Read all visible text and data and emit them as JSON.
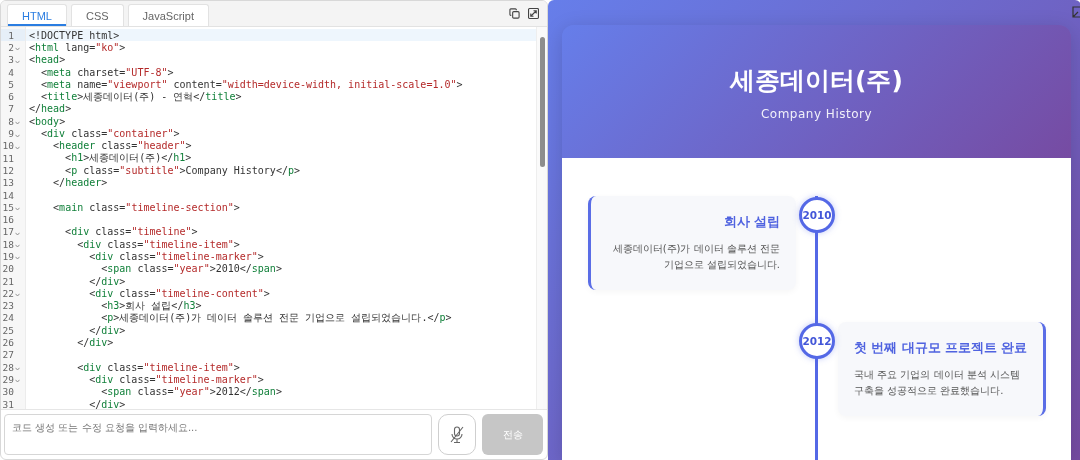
{
  "editor": {
    "tabs": [
      {
        "label": "HTML",
        "selected": true
      },
      {
        "label": "CSS",
        "selected": false
      },
      {
        "label": "JavaScript",
        "selected": false
      }
    ],
    "lines": [
      {
        "number": "1",
        "foldable": false,
        "current": true,
        "tokens": [
          {
            "kind": "text",
            "text": "<!DOCTYPE html>"
          }
        ]
      },
      {
        "number": "2",
        "foldable": true,
        "current": false,
        "tokens": [
          {
            "kind": "text",
            "text": "<"
          },
          {
            "kind": "tag",
            "text": "html"
          },
          {
            "kind": "text",
            "text": " lang="
          },
          {
            "kind": "str",
            "text": "\"ko\""
          },
          {
            "kind": "text",
            "text": ">"
          }
        ]
      },
      {
        "number": "3",
        "foldable": true,
        "current": false,
        "tokens": [
          {
            "kind": "text",
            "text": "<"
          },
          {
            "kind": "tag",
            "text": "head"
          },
          {
            "kind": "text",
            "text": ">"
          }
        ]
      },
      {
        "number": "4",
        "foldable": false,
        "current": false,
        "tokens": [
          {
            "kind": "text",
            "text": "  <"
          },
          {
            "kind": "tag",
            "text": "meta"
          },
          {
            "kind": "text",
            "text": " charset="
          },
          {
            "kind": "str",
            "text": "\"UTF-8\""
          },
          {
            "kind": "text",
            "text": ">"
          }
        ]
      },
      {
        "number": "5",
        "foldable": false,
        "current": false,
        "tokens": [
          {
            "kind": "text",
            "text": "  <"
          },
          {
            "kind": "tag",
            "text": "meta"
          },
          {
            "kind": "text",
            "text": " name="
          },
          {
            "kind": "str",
            "text": "\"viewport\""
          },
          {
            "kind": "text",
            "text": " content="
          },
          {
            "kind": "str",
            "text": "\"width=device-width, initial-scale=1.0\""
          },
          {
            "kind": "text",
            "text": ">"
          }
        ]
      },
      {
        "number": "6",
        "foldable": false,
        "current": false,
        "tokens": [
          {
            "kind": "text",
            "text": "  <"
          },
          {
            "kind": "tag",
            "text": "title"
          },
          {
            "kind": "text",
            "text": ">세종데이터(주) - 연혁</"
          },
          {
            "kind": "tag",
            "text": "title"
          },
          {
            "kind": "text",
            "text": ">"
          }
        ]
      },
      {
        "number": "7",
        "foldable": false,
        "current": false,
        "tokens": [
          {
            "kind": "text",
            "text": "</"
          },
          {
            "kind": "tag",
            "text": "head"
          },
          {
            "kind": "text",
            "text": ">"
          }
        ]
      },
      {
        "number": "8",
        "foldable": true,
        "current": false,
        "tokens": [
          {
            "kind": "text",
            "text": "<"
          },
          {
            "kind": "tag",
            "text": "body"
          },
          {
            "kind": "text",
            "text": ">"
          }
        ]
      },
      {
        "number": "9",
        "foldable": true,
        "current": false,
        "tokens": [
          {
            "kind": "text",
            "text": "  <"
          },
          {
            "kind": "tag",
            "text": "div"
          },
          {
            "kind": "text",
            "text": " class="
          },
          {
            "kind": "str",
            "text": "\"container\""
          },
          {
            "kind": "text",
            "text": ">"
          }
        ]
      },
      {
        "number": "10",
        "foldable": true,
        "current": false,
        "tokens": [
          {
            "kind": "text",
            "text": "    <"
          },
          {
            "kind": "tag",
            "text": "header"
          },
          {
            "kind": "text",
            "text": " class="
          },
          {
            "kind": "str",
            "text": "\"header\""
          },
          {
            "kind": "text",
            "text": ">"
          }
        ]
      },
      {
        "number": "11",
        "foldable": false,
        "current": false,
        "tokens": [
          {
            "kind": "text",
            "text": "      <"
          },
          {
            "kind": "tag",
            "text": "h1"
          },
          {
            "kind": "text",
            "text": ">세종데이터(주)</"
          },
          {
            "kind": "tag",
            "text": "h1"
          },
          {
            "kind": "text",
            "text": ">"
          }
        ]
      },
      {
        "number": "12",
        "foldable": false,
        "current": false,
        "tokens": [
          {
            "kind": "text",
            "text": "      <"
          },
          {
            "kind": "tag",
            "text": "p"
          },
          {
            "kind": "text",
            "text": " class="
          },
          {
            "kind": "str",
            "text": "\"subtitle\""
          },
          {
            "kind": "text",
            "text": ">Company History</"
          },
          {
            "kind": "tag",
            "text": "p"
          },
          {
            "kind": "text",
            "text": ">"
          }
        ]
      },
      {
        "number": "13",
        "foldable": false,
        "current": false,
        "tokens": [
          {
            "kind": "text",
            "text": "    </"
          },
          {
            "kind": "tag",
            "text": "header"
          },
          {
            "kind": "text",
            "text": ">"
          }
        ]
      },
      {
        "number": "14",
        "foldable": false,
        "current": false
      },
      {
        "number": "15",
        "foldable": true,
        "current": false,
        "tokens": [
          {
            "kind": "text",
            "text": "    <"
          },
          {
            "kind": "tag",
            "text": "main"
          },
          {
            "kind": "text",
            "text": " class="
          },
          {
            "kind": "str",
            "text": "\"timeline-section\""
          },
          {
            "kind": "text",
            "text": ">"
          }
        ]
      },
      {
        "number": "16",
        "foldable": false,
        "current": false
      },
      {
        "number": "17",
        "foldable": true,
        "current": false,
        "tokens": [
          {
            "kind": "text",
            "text": "      <"
          },
          {
            "kind": "tag",
            "text": "div"
          },
          {
            "kind": "text",
            "text": " class="
          },
          {
            "kind": "str",
            "text": "\"timeline\""
          },
          {
            "kind": "text",
            "text": ">"
          }
        ]
      },
      {
        "number": "18",
        "foldable": true,
        "current": false,
        "tokens": [
          {
            "kind": "text",
            "text": "        <"
          },
          {
            "kind": "tag",
            "text": "div"
          },
          {
            "kind": "text",
            "text": " class="
          },
          {
            "kind": "str",
            "text": "\"timeline-item\""
          },
          {
            "kind": "text",
            "text": ">"
          }
        ]
      },
      {
        "number": "19",
        "foldable": true,
        "current": false,
        "tokens": [
          {
            "kind": "text",
            "text": "          <"
          },
          {
            "kind": "tag",
            "text": "div"
          },
          {
            "kind": "text",
            "text": " class="
          },
          {
            "kind": "str",
            "text": "\"timeline-marker\""
          },
          {
            "kind": "text",
            "text": ">"
          }
        ]
      },
      {
        "number": "20",
        "foldable": false,
        "current": false,
        "tokens": [
          {
            "kind": "text",
            "text": "            <"
          },
          {
            "kind": "tag",
            "text": "span"
          },
          {
            "kind": "text",
            "text": " class="
          },
          {
            "kind": "str",
            "text": "\"year\""
          },
          {
            "kind": "text",
            "text": ">2010</"
          },
          {
            "kind": "tag",
            "text": "span"
          },
          {
            "kind": "text",
            "text": ">"
          }
        ]
      },
      {
        "number": "21",
        "foldable": false,
        "current": false,
        "tokens": [
          {
            "kind": "text",
            "text": "          </"
          },
          {
            "kind": "tag",
            "text": "div"
          },
          {
            "kind": "text",
            "text": ">"
          }
        ]
      },
      {
        "number": "22",
        "foldable": true,
        "current": false,
        "tokens": [
          {
            "kind": "text",
            "text": "          <"
          },
          {
            "kind": "tag",
            "text": "div"
          },
          {
            "kind": "text",
            "text": " class="
          },
          {
            "kind": "str",
            "text": "\"timeline-content\""
          },
          {
            "kind": "text",
            "text": ">"
          }
        ]
      },
      {
        "number": "23",
        "foldable": false,
        "current": false,
        "tokens": [
          {
            "kind": "text",
            "text": "            <"
          },
          {
            "kind": "tag",
            "text": "h3"
          },
          {
            "kind": "text",
            "text": ">회사 설립</"
          },
          {
            "kind": "tag",
            "text": "h3"
          },
          {
            "kind": "text",
            "text": ">"
          }
        ]
      },
      {
        "number": "24",
        "foldable": false,
        "current": false,
        "tokens": [
          {
            "kind": "text",
            "text": "            <"
          },
          {
            "kind": "tag",
            "text": "p"
          },
          {
            "kind": "text",
            "text": ">세종데이터(주)가 데이터 솔루션 전문 기업으로 설립되었습니다.</"
          },
          {
            "kind": "tag",
            "text": "p"
          },
          {
            "kind": "text",
            "text": ">"
          }
        ]
      },
      {
        "number": "25",
        "foldable": false,
        "current": false,
        "tokens": [
          {
            "kind": "text",
            "text": "          </"
          },
          {
            "kind": "tag",
            "text": "div"
          },
          {
            "kind": "text",
            "text": ">"
          }
        ]
      },
      {
        "number": "26",
        "foldable": false,
        "current": false,
        "tokens": [
          {
            "kind": "text",
            "text": "        </"
          },
          {
            "kind": "tag",
            "text": "div"
          },
          {
            "kind": "text",
            "text": ">"
          }
        ]
      },
      {
        "number": "27",
        "foldable": false,
        "current": false
      },
      {
        "number": "28",
        "foldable": true,
        "current": false,
        "tokens": [
          {
            "kind": "text",
            "text": "        <"
          },
          {
            "kind": "tag",
            "text": "div"
          },
          {
            "kind": "text",
            "text": " class="
          },
          {
            "kind": "str",
            "text": "\"timeline-item\""
          },
          {
            "kind": "text",
            "text": ">"
          }
        ]
      },
      {
        "number": "29",
        "foldable": true,
        "current": false,
        "tokens": [
          {
            "kind": "text",
            "text": "          <"
          },
          {
            "kind": "tag",
            "text": "div"
          },
          {
            "kind": "text",
            "text": " class="
          },
          {
            "kind": "str",
            "text": "\"timeline-marker\""
          },
          {
            "kind": "text",
            "text": ">"
          }
        ]
      },
      {
        "number": "30",
        "foldable": false,
        "current": false,
        "tokens": [
          {
            "kind": "text",
            "text": "            <"
          },
          {
            "kind": "tag",
            "text": "span"
          },
          {
            "kind": "text",
            "text": " class="
          },
          {
            "kind": "str",
            "text": "\"year\""
          },
          {
            "kind": "text",
            "text": ">2012</"
          },
          {
            "kind": "tag",
            "text": "span"
          },
          {
            "kind": "text",
            "text": ">"
          }
        ]
      },
      {
        "number": "31",
        "foldable": false,
        "current": false,
        "tokens": [
          {
            "kind": "text",
            "text": "          </"
          },
          {
            "kind": "tag",
            "text": "div"
          },
          {
            "kind": "text",
            "text": ">"
          }
        ]
      }
    ]
  },
  "prompt": {
    "placeholder": "코드 생성 또는 수정 요청을 입력하세요...",
    "send_label": "전송",
    "send_disabled": true
  },
  "preview": {
    "title": "세종데이터(주)",
    "subtitle": "Company History",
    "timeline": [
      {
        "year": "2010",
        "kind": "left",
        "title": "회사 설립",
        "text": "세종데이터(주)가 데이터 솔루션 전문 기업으로 설립되었습니다."
      },
      {
        "year": "2012",
        "kind": "right",
        "title": "첫 번째 대규모 프로젝트 완료",
        "text": "국내 주요 기업의 데이터 분석 시스템 구축을 성공적으로 완료했습니다."
      }
    ]
  }
}
